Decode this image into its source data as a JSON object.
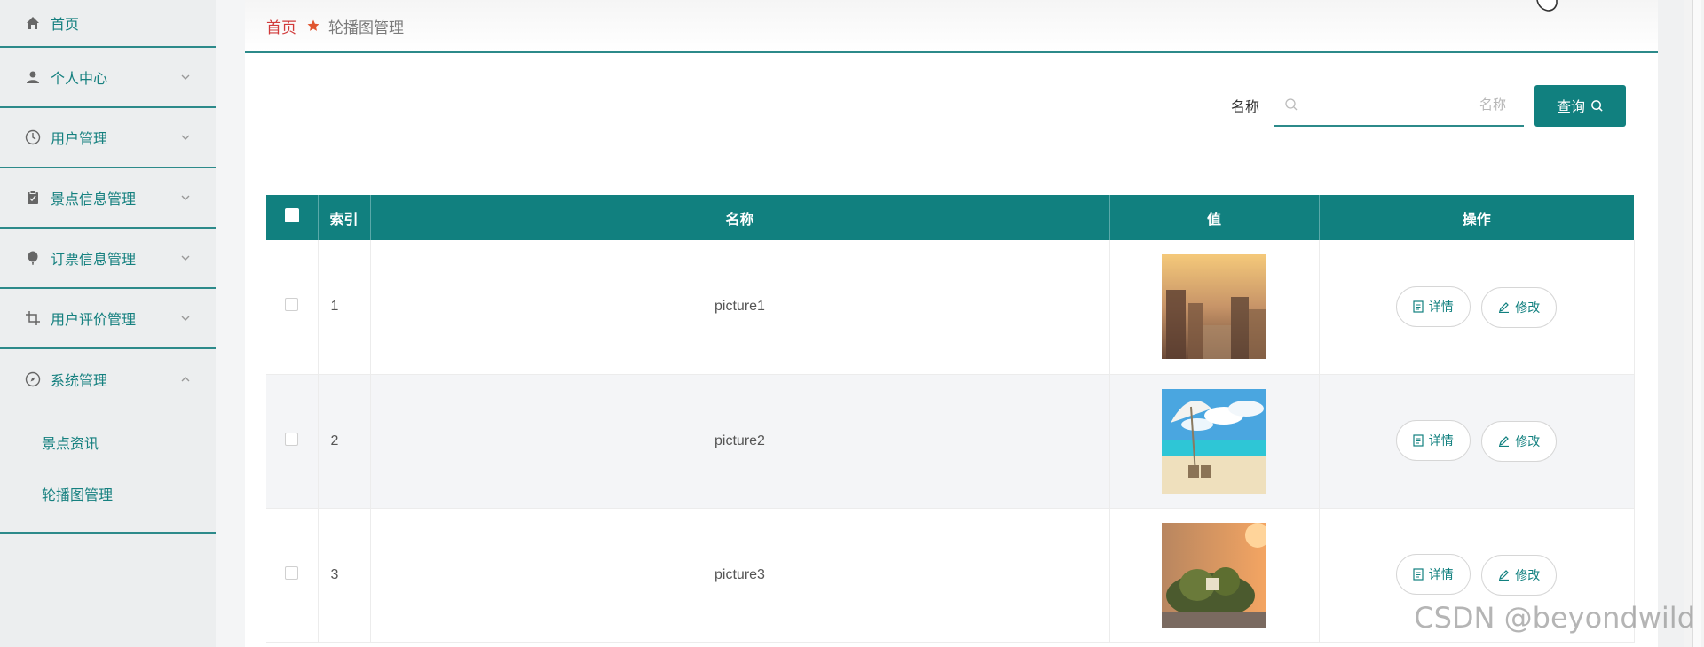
{
  "sidebar": {
    "items": [
      {
        "label": "首页",
        "icon": "home-icon"
      },
      {
        "label": "个人中心",
        "icon": "user-icon"
      },
      {
        "label": "用户管理",
        "icon": "clock-icon"
      },
      {
        "label": "景点信息管理",
        "icon": "clipboard-icon"
      },
      {
        "label": "订票信息管理",
        "icon": "balloon-icon"
      },
      {
        "label": "用户评价管理",
        "icon": "crop-icon"
      },
      {
        "label": "系统管理",
        "icon": "compass-icon"
      }
    ],
    "subitems": [
      {
        "label": "景点资讯"
      },
      {
        "label": "轮播图管理"
      }
    ]
  },
  "breadcrumb": {
    "home": "首页",
    "current": "轮播图管理"
  },
  "search": {
    "label": "名称",
    "placeholder": "名称",
    "button": "查询"
  },
  "table": {
    "headers": [
      "索引",
      "名称",
      "值",
      "操作"
    ],
    "rows": [
      {
        "index": "1",
        "name": "picture1",
        "thumb": "city-canal-sunset"
      },
      {
        "index": "2",
        "name": "picture2",
        "thumb": "beach-umbrella"
      },
      {
        "index": "3",
        "name": "picture3",
        "thumb": "island-sunset"
      }
    ],
    "actions": {
      "detail": "详情",
      "edit": "修改"
    }
  },
  "watermark": "CSDN @beyondwild",
  "colors": {
    "accent": "#11807f",
    "breadcrumb_home": "#d13a3a"
  }
}
